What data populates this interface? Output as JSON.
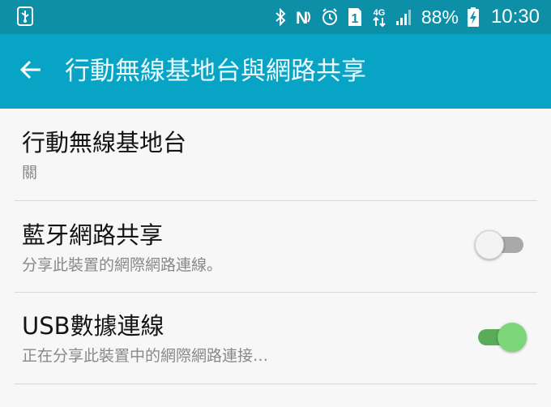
{
  "status_bar": {
    "icons": [
      "usb-icon",
      "bluetooth-icon",
      "nfc-icon",
      "alarm-icon",
      "sim-1-icon",
      "network-4g-icon",
      "signal-icon",
      "battery-charging-icon"
    ],
    "sim_label": "1",
    "network_label": "4G",
    "battery": "88%",
    "time": "10:30"
  },
  "app_bar": {
    "back_icon": "arrow-left-icon",
    "title": "行動無線基地台與網路共享"
  },
  "settings": [
    {
      "title": "行動無線基地台",
      "subtitle": "關"
    },
    {
      "title": "藍牙網路共享",
      "subtitle": "分享此裝置的網際網路連線。",
      "toggle_on": false
    },
    {
      "title": "USB數據連線",
      "subtitle": "正在分享此裝置中的網際網路連接…",
      "toggle_on": true
    }
  ],
  "colors": {
    "status_bar": "#0d8fa8",
    "app_bar": "#07a4c6",
    "background": "#f7f7f7",
    "toggle_on_track": "#5aac5a",
    "toggle_on_thumb": "#7dd57a",
    "toggle_off_track": "#a9a9a9"
  }
}
